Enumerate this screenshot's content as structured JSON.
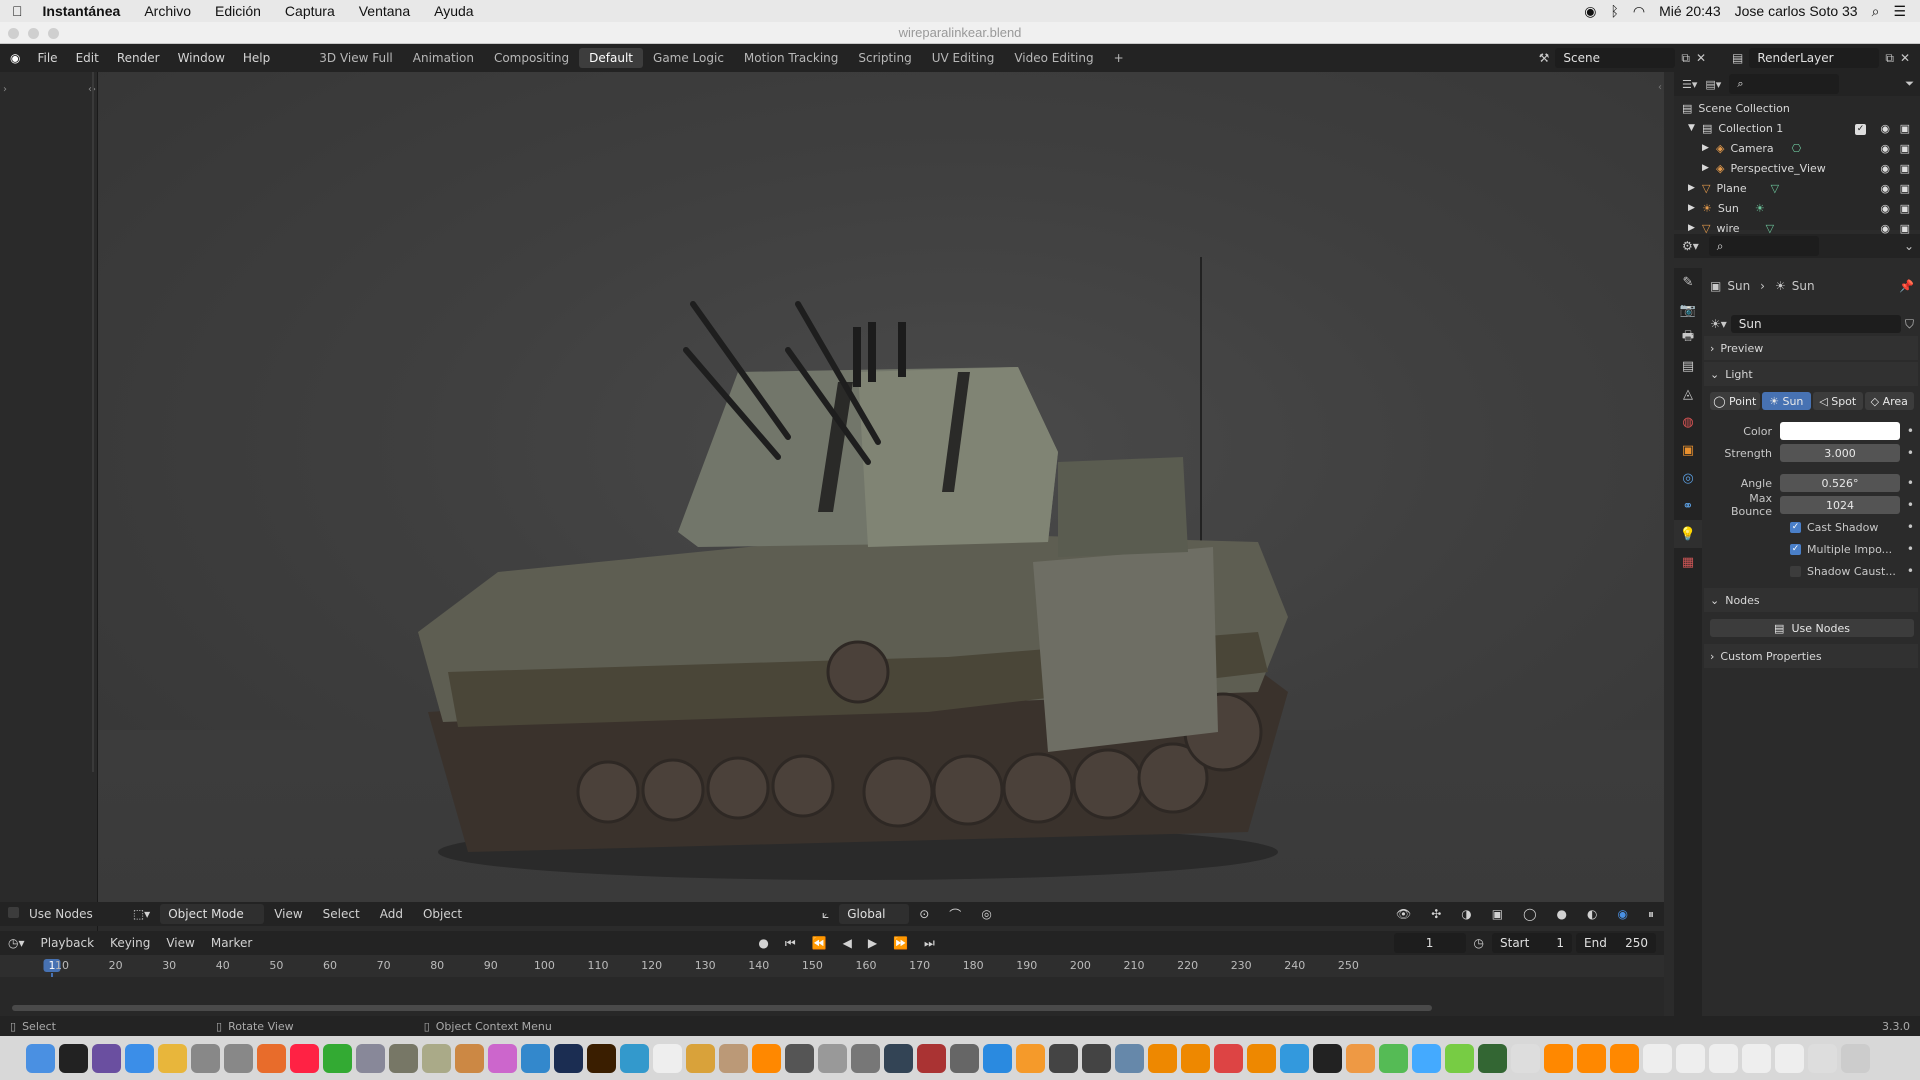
{
  "macos": {
    "app_name": "Instantánea",
    "menu": [
      "Archivo",
      "Edición",
      "Captura",
      "Ventana",
      "Ayuda"
    ],
    "clock": "Mié 20:43",
    "user": "Jose carlos Soto 33"
  },
  "window": {
    "title": "wireparalinkear.blend"
  },
  "topbar": {
    "menus": [
      "File",
      "Edit",
      "Render",
      "Window",
      "Help"
    ],
    "workspaces": [
      "3D View Full",
      "Animation",
      "Compositing",
      "Default",
      "Game Logic",
      "Motion Tracking",
      "Scripting",
      "UV Editing",
      "Video Editing"
    ],
    "active_workspace": "Default",
    "add_label": "+",
    "scene": "Scene",
    "render_layer": "RenderLayer"
  },
  "viewport": {
    "use_nodes": "Use Nodes",
    "mode": "Object Mode",
    "menus": [
      "View",
      "Select",
      "Add",
      "Object"
    ],
    "orientation": "Global"
  },
  "timeline": {
    "menus": [
      "Playback",
      "Keying",
      "View",
      "Marker"
    ],
    "current_frame": "1",
    "start_label": "Start",
    "start": "1",
    "end_label": "End",
    "end": "250",
    "ticks": [
      "1",
      "10",
      "20",
      "30",
      "40",
      "50",
      "60",
      "70",
      "80",
      "90",
      "100",
      "110",
      "120",
      "130",
      "140",
      "150",
      "160",
      "170",
      "180",
      "190",
      "200",
      "210",
      "220",
      "230",
      "240",
      "250"
    ]
  },
  "status": {
    "select": "Select",
    "rotate": "Rotate View",
    "context": "Object Context Menu",
    "version": "3.3.0"
  },
  "outliner": {
    "root": "Scene Collection",
    "items": [
      {
        "label": "Collection 1",
        "level": 1
      },
      {
        "label": "Camera",
        "level": 2
      },
      {
        "label": "Perspective_View",
        "level": 2
      },
      {
        "label": "Plane",
        "level": 1
      },
      {
        "label": "Sun",
        "level": 1
      },
      {
        "label": "wire",
        "level": 1
      }
    ]
  },
  "properties": {
    "breadcrumb_obj": "Sun",
    "breadcrumb_data": "Sun",
    "datablock": "Sun",
    "preview": "Preview",
    "light": "Light",
    "light_types": [
      "Point",
      "Sun",
      "Spot",
      "Area"
    ],
    "active_type": "Sun",
    "color_label": "Color",
    "strength_label": "Strength",
    "strength": "3.000",
    "angle_label": "Angle",
    "angle": "0.526°",
    "max_bounce_label": "Max Bounce",
    "max_bounce": "1024",
    "cast_shadow": "Cast Shadow",
    "multiple_importance": "Multiple Impo...",
    "shadow_caustics": "Shadow Caust...",
    "nodes": "Nodes",
    "use_nodes": "Use Nodes",
    "custom_properties": "Custom Properties"
  }
}
